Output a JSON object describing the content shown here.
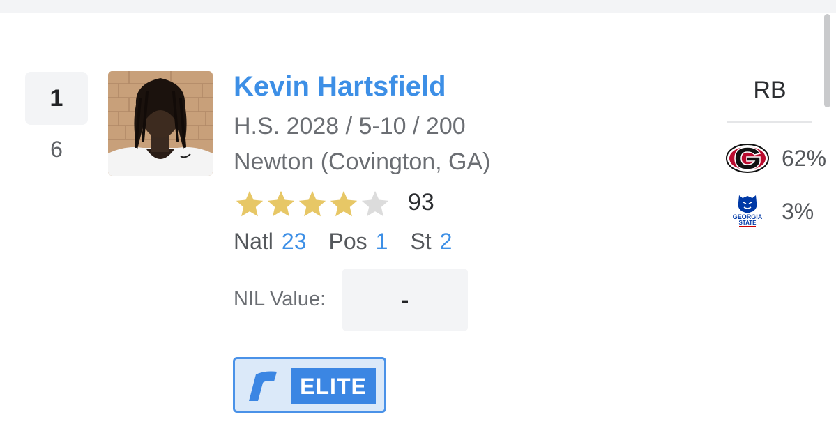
{
  "player": {
    "rank": "1",
    "previous_rank": "6",
    "name": "Kevin Hartsfield",
    "class_height_weight": "H.S. 2028 / 5-10 / 200",
    "school": "Newton (Covington, GA)",
    "stars": 4,
    "max_stars": 5,
    "rating": "93",
    "position": "RB",
    "rankings": {
      "natl_label": "Natl",
      "natl_value": "23",
      "pos_label": "Pos",
      "pos_value": "1",
      "st_label": "St",
      "st_value": "2"
    },
    "nil_label": "NIL Value:",
    "nil_value": "-",
    "badge_tier": "ELITE"
  },
  "predictions": [
    {
      "school": "Georgia",
      "logo_icon": "georgia-g-logo",
      "percent": "62%"
    },
    {
      "school": "Georgia State",
      "logo_text_line1": "GEORGIA",
      "logo_text_line2": "STATE",
      "logo_icon": "georgia-state-panther-logo",
      "percent": "3%"
    }
  ],
  "colors": {
    "accent_blue": "#3d8fe6",
    "star_gold": "#e7c766",
    "star_empty": "#dcdcdc",
    "georgia_red": "#ba0c2f",
    "georgia_state_blue": "#0039a6"
  }
}
